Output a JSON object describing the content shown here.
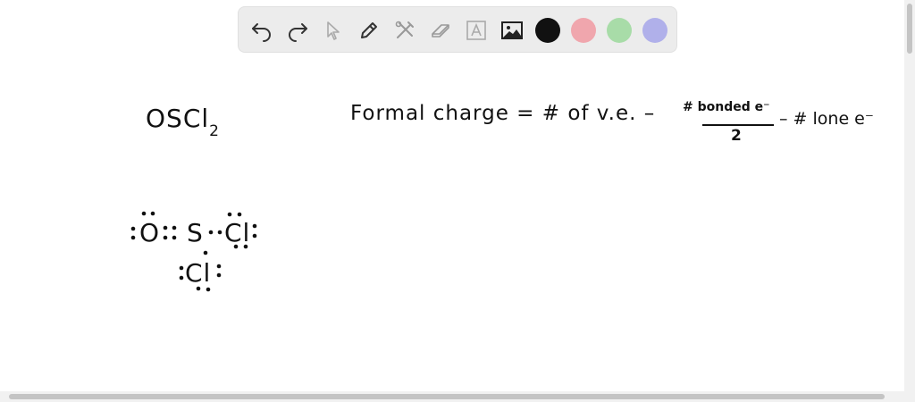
{
  "toolbar": {
    "tools": [
      {
        "name": "undo-icon"
      },
      {
        "name": "redo-icon"
      },
      {
        "name": "select-cursor-icon"
      },
      {
        "name": "pen-icon"
      },
      {
        "name": "tools-icon"
      },
      {
        "name": "eraser-icon"
      },
      {
        "name": "text-box-icon"
      },
      {
        "name": "image-icon"
      }
    ],
    "colors": [
      "#111111",
      "#f0a6ad",
      "#a8dca8",
      "#b0b0ea"
    ],
    "selected_color": "#111111"
  },
  "board": {
    "formula_name": "OSCl",
    "formula_subscript": "2",
    "fc_left": "Formal charge = # of v.e. –",
    "fc_numerator": "# bonded e⁻",
    "fc_denominator": "2",
    "fc_right": "– # lone e⁻",
    "atom_o": "O",
    "atom_s": "S",
    "atom_cl_right": "Cl",
    "atom_cl_bottom": "Cl"
  }
}
